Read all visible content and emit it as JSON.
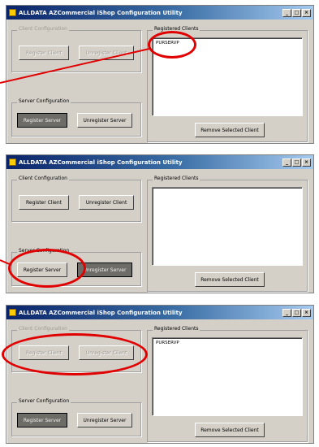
{
  "colors": {
    "highlight": "#e00000",
    "titlebar_start": "#0a246a",
    "titlebar_end": "#a6caf0",
    "window_bg": "#d4d0c8"
  },
  "window_title": "ALLDATA AZCommercial iShop Configuration Utility",
  "titlebar_buttons": [
    "_",
    "□",
    "×"
  ],
  "groups": {
    "client_configuration": "Client Configuration",
    "server_configuration": "Server Configuration",
    "registered_clients": "Registered Clients"
  },
  "buttons": {
    "register_client": "Register Client",
    "unregister_client": "Unregister Client",
    "register_server": "Register Server",
    "unregister_server": "Unregister Server",
    "remove_selected_client": "Remove Selected Client"
  },
  "panels": [
    {
      "registered_clients": [
        "PURSERVP"
      ]
    },
    {
      "registered_clients": []
    },
    {
      "registered_clients": [
        "PURSERVP"
      ]
    }
  ]
}
